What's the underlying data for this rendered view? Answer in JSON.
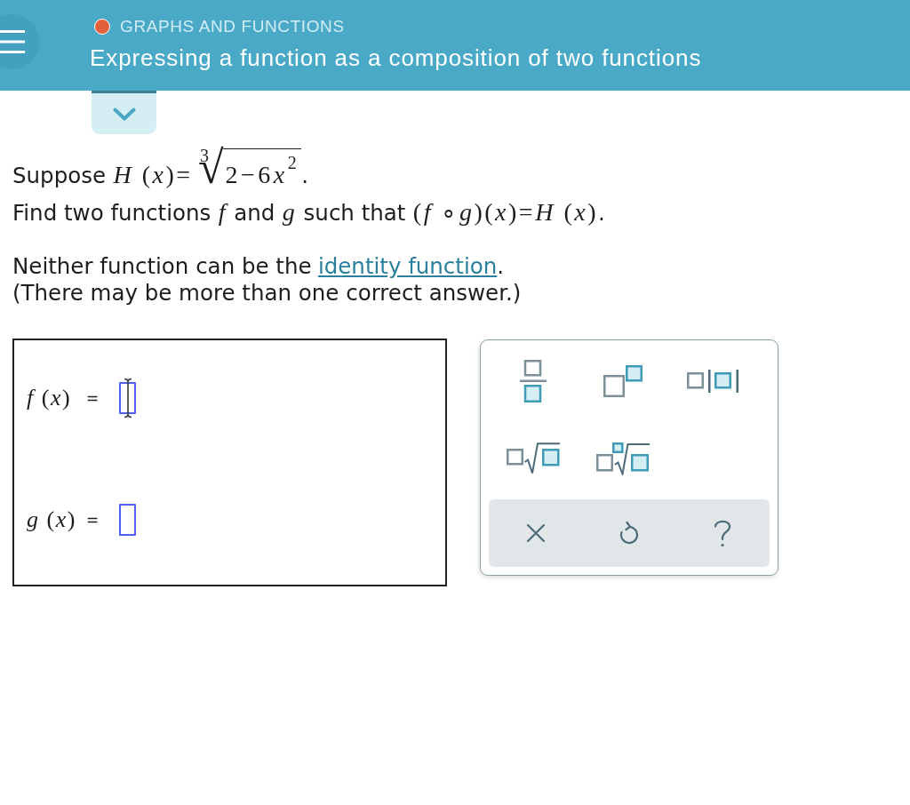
{
  "header": {
    "status_dot": {
      "color": "#e2603c"
    },
    "category": "GRAPHS AND FUNCTIONS",
    "title": "Expressing a function as a composition of two functions"
  },
  "toggle": {
    "expanded": false
  },
  "statement": [
    {
      "segments": [
        {
          "kind": "text",
          "text": "Suppose"
        },
        {
          "kind": "math",
          "text": "*H* (*x*)="
        },
        {
          "kind": "root",
          "index": "3",
          "sign": "√",
          "radicand": [
            {
              "kind": "num",
              "text": "2−6"
            },
            {
              "kind": "var",
              "text": "x"
            },
            {
              "kind": "sup",
              "text": "2"
            }
          ]
        },
        {
          "kind": "punct",
          "text": "."
        }
      ]
    },
    {
      "segments": [
        {
          "kind": "text",
          "text": "Find two functions"
        },
        {
          "kind": "math",
          "text": "*f*"
        },
        {
          "kind": "text",
          "text": "and"
        },
        {
          "kind": "math",
          "text": "*g*"
        },
        {
          "kind": "text",
          "text": "such that"
        },
        {
          "kind": "math",
          "text": "(*f* ∘*g*)(*x*)=*H* (*x*)"
        },
        {
          "kind": "punct",
          "text": "."
        }
      ]
    }
  ],
  "notes": [
    {
      "segments": [
        {
          "kind": "text",
          "text": "Neither function can be the"
        },
        {
          "kind": "link",
          "text": "identity function"
        },
        {
          "kind": "punct",
          "text": "."
        }
      ]
    },
    {
      "segments": [
        {
          "kind": "text",
          "text": "(There may be more than one correct answer.)"
        }
      ]
    }
  ],
  "answers": [
    {
      "label": "*f* (*x*)",
      "equals": "=",
      "hovered": true
    },
    {
      "label": "*g* (*x*)",
      "equals": "=",
      "hovered": false
    }
  ],
  "keypad": {
    "keys": [
      {
        "kind": "fraction"
      },
      {
        "kind": "superscript"
      },
      {
        "kind": "absolute_value"
      },
      {
        "kind": "square_root"
      },
      {
        "kind": "nth_root"
      }
    ],
    "actions": [
      {
        "kind": "clear"
      },
      {
        "kind": "undo"
      },
      {
        "kind": "help"
      }
    ]
  }
}
